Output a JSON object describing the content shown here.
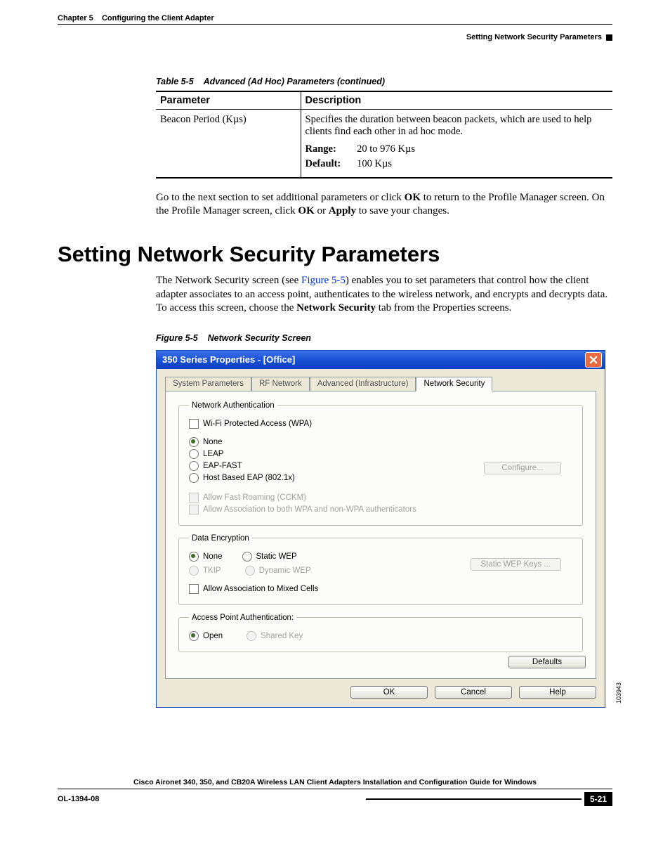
{
  "header": {
    "chapter_label": "Chapter 5",
    "chapter_title": "Configuring the Client Adapter",
    "section_right": "Setting Network Security Parameters"
  },
  "table": {
    "caption_num": "Table 5-5",
    "caption_title": "Advanced (Ad Hoc) Parameters (continued)",
    "head_param": "Parameter",
    "head_desc": "Description",
    "row": {
      "param": "Beacon Period (Kµs)",
      "desc": "Specifies the duration between beacon packets, which are used to help clients find each other in ad hoc mode.",
      "range_label": "Range:",
      "range_value": "20 to 976 Kµs",
      "default_label": "Default:",
      "default_value": "100 Kµs"
    }
  },
  "para1_a": "Go to the next section to set additional parameters or click ",
  "para1_b": "OK",
  "para1_c": " to return to the Profile Manager screen. On the Profile Manager screen, click ",
  "para1_d": "OK",
  "para1_e": " or ",
  "para1_f": "Apply",
  "para1_g": " to save your changes.",
  "h1": "Setting Network Security Parameters",
  "para2_a": "The Network Security screen (see ",
  "para2_link": "Figure 5-5",
  "para2_b": ") enables you to set parameters that control how the client adapter associates to an access point, authenticates to the wireless network, and encrypts and decrypts data. To access this screen, choose the ",
  "para2_bold": "Network Security",
  "para2_c": " tab from the Properties screens.",
  "figure": {
    "caption_num": "Figure 5-5",
    "caption_title": "Network Security Screen"
  },
  "dialog": {
    "title": "350 Series Properties - [Office]",
    "tabs": {
      "t1": "System Parameters",
      "t2": "RF Network",
      "t3": "Advanced (Infrastructure)",
      "t4": "Network Security"
    },
    "groups": {
      "auth_legend": "Network Authentication",
      "wpa": "Wi-Fi Protected Access (WPA)",
      "none": "None",
      "leap": "LEAP",
      "eapfast": "EAP-FAST",
      "hosteap": "Host Based EAP (802.1x)",
      "configure": "Configure...",
      "fastroam": "Allow Fast Roaming (CCKM)",
      "assoc_both": "Allow Association to both WPA and non-WPA authenticators",
      "enc_legend": "Data Encryption",
      "enc_none": "None",
      "enc_static": "Static WEP",
      "enc_tkip": "TKIP",
      "enc_dyn": "Dynamic WEP",
      "wep_btn": "Static WEP Keys ...",
      "mixed": "Allow Association to Mixed Cells",
      "ap_legend": "Access Point Authentication:",
      "ap_open": "Open",
      "ap_shared": "Shared Key",
      "defaults": "Defaults"
    },
    "buttons": {
      "ok": "OK",
      "cancel": "Cancel",
      "help": "Help"
    },
    "img_id": "103943"
  },
  "footer": {
    "guide": "Cisco Aironet 340, 350, and CB20A Wireless LAN Client Adapters Installation and Configuration Guide for Windows",
    "doc_id": "OL-1394-08",
    "page": "5-21"
  }
}
